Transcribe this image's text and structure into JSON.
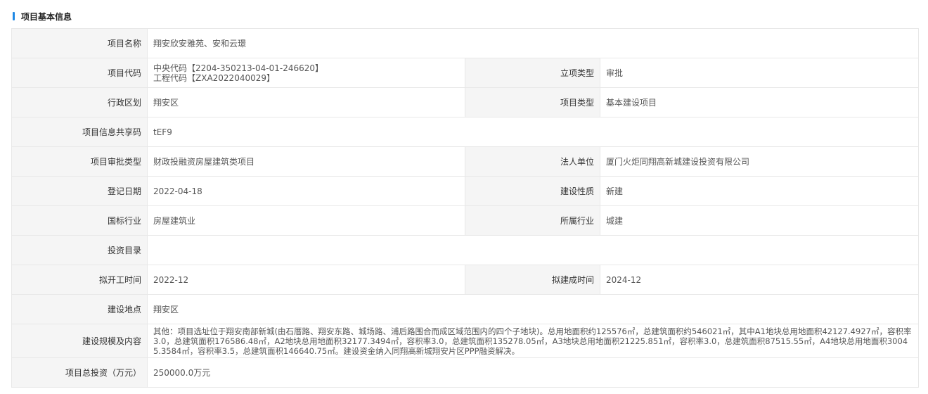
{
  "section": {
    "title": "项目基本信息"
  },
  "rows": {
    "project_name": {
      "label": "项目名称",
      "value": "翔安欣安雅苑、安和云璟"
    },
    "project_code": {
      "label": "项目代码",
      "central_code": "中央代码【2204-350213-04-01-246620】",
      "engineering_code": "工程代码【ZXA2022040029】"
    },
    "approval_type_lx": {
      "label": "立项类型",
      "value": "审批"
    },
    "admin_region": {
      "label": "行政区划",
      "value": "翔安区"
    },
    "project_type": {
      "label": "项目类型",
      "value": "基本建设项目"
    },
    "share_code": {
      "label": "项目信息共享码",
      "value": "tEF9"
    },
    "approval_category": {
      "label": "项目审批类型",
      "value": "财政投融资房屋建筑类项目"
    },
    "legal_unit": {
      "label": "法人单位",
      "value": "厦门火炬同翔高新城建设投资有限公司"
    },
    "register_date": {
      "label": "登记日期",
      "value": "2022-04-18"
    },
    "construction_nature": {
      "label": "建设性质",
      "value": "新建"
    },
    "national_industry": {
      "label": "国标行业",
      "value": "房屋建筑业"
    },
    "industry": {
      "label": "所属行业",
      "value": "城建"
    },
    "investment_catalog": {
      "label": "投资目录",
      "value": ""
    },
    "planned_start": {
      "label": "拟开工时间",
      "value": "2022-12"
    },
    "planned_finish": {
      "label": "拟建成时间",
      "value": "2024-12"
    },
    "location": {
      "label": "建设地点",
      "value": "翔安区"
    },
    "scale_content": {
      "label": "建设规模及内容",
      "value": "其他：项目选址位于翔安南部新城(由石厝路、翔安东路、城场路、浦后路围合而成区域范围内的四个子地块)。总用地面积约125576㎡，总建筑面积约546021㎡，其中A1地块总用地面积42127.4927㎡，容积率3.0，总建筑面积176586.48㎡，A2地块总用地面积32177.3494㎡，容积率3.0，总建筑面积135278.05㎡，A3地块总用地面积21225.851㎡，容积率3.0，总建筑面积87515.55㎡，A4地块总用地面积30045.3584㎡，容积率3.5，总建筑面积146640.75㎡。建设资金纳入同翔高新城翔安片区PPP融资解决。"
    },
    "total_investment": {
      "label": "项目总投资（万元）",
      "value": "250000.0万元"
    }
  }
}
